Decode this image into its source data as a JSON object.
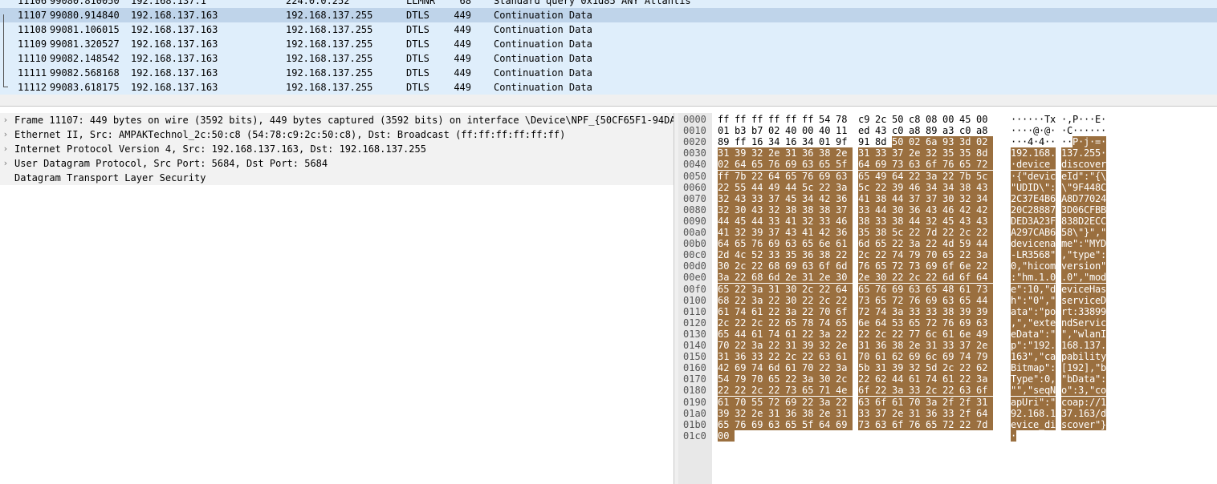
{
  "packet_list": {
    "rows": [
      {
        "no": "11106",
        "time": "99080.810050",
        "src": "192.168.137.1",
        "dst": "224.0.0.252",
        "proto": "LLMNR",
        "len": "68",
        "info": "Standard query 0x1d85 ANY Atlantis",
        "selected": false
      },
      {
        "no": "11107",
        "time": "99080.914840",
        "src": "192.168.137.163",
        "dst": "192.168.137.255",
        "proto": "DTLS",
        "len": "449",
        "info": "Continuation Data",
        "selected": true
      },
      {
        "no": "11108",
        "time": "99081.106015",
        "src": "192.168.137.163",
        "dst": "192.168.137.255",
        "proto": "DTLS",
        "len": "449",
        "info": "Continuation Data",
        "selected": false
      },
      {
        "no": "11109",
        "time": "99081.320527",
        "src": "192.168.137.163",
        "dst": "192.168.137.255",
        "proto": "DTLS",
        "len": "449",
        "info": "Continuation Data",
        "selected": false
      },
      {
        "no": "11110",
        "time": "99082.148542",
        "src": "192.168.137.163",
        "dst": "192.168.137.255",
        "proto": "DTLS",
        "len": "449",
        "info": "Continuation Data",
        "selected": false
      },
      {
        "no": "11111",
        "time": "99082.568168",
        "src": "192.168.137.163",
        "dst": "192.168.137.255",
        "proto": "DTLS",
        "len": "449",
        "info": "Continuation Data",
        "selected": false
      },
      {
        "no": "11112",
        "time": "99083.618175",
        "src": "192.168.137.163",
        "dst": "192.168.137.255",
        "proto": "DTLS",
        "len": "449",
        "info": "Continuation Data",
        "selected": false
      }
    ]
  },
  "details": {
    "rows": [
      {
        "text": "Frame 11107: 449 bytes on wire (3592 bits), 449 bytes captured (3592 bits) on interface \\Device\\NPF_{50CF65F1-94DA-",
        "expandable": true
      },
      {
        "text": "Ethernet II, Src: AMPAKTechnol_2c:50:c8 (54:78:c9:2c:50:c8), Dst: Broadcast (ff:ff:ff:ff:ff:ff)",
        "expandable": true
      },
      {
        "text": "Internet Protocol Version 4, Src: 192.168.137.163, Dst: 192.168.137.255",
        "expandable": true
      },
      {
        "text": "User Datagram Protocol, Src Port: 5684, Dst Port: 5684",
        "expandable": true
      },
      {
        "text": "Datagram Transport Layer Security",
        "expandable": false
      }
    ]
  },
  "bytes": {
    "highlight_start": 42,
    "rows": [
      {
        "offset": "0000",
        "hex": "ff ff ff ff ff ff 54 78 c9 2c 50 c8 08 00 45 00",
        "ascii": "······Tx ·,P···E·"
      },
      {
        "offset": "0010",
        "hex": "01 b3 b7 02 40 00 40 11 ed 43 c0 a8 89 a3 c0 a8",
        "ascii": "····@·@· ·C······"
      },
      {
        "offset": "0020",
        "hex": "89 ff 16 34 16 34 01 9f 91 8d 50 02 6a 93 3d 02",
        "ascii": "···4·4·· ··P·j·=·"
      },
      {
        "offset": "0030",
        "hex": "31 39 32 2e 31 36 38 2e 31 33 37 2e 32 35 35 8d",
        "ascii": "192.168. 137.255·"
      },
      {
        "offset": "0040",
        "hex": "02 64 65 76 69 63 65 5f 64 69 73 63 6f 76 65 72",
        "ascii": "·device_ discover"
      },
      {
        "offset": "0050",
        "hex": "ff 7b 22 64 65 76 69 63 65 49 64 22 3a 22 7b 5c",
        "ascii": "·{\"devic eId\":\"{\\"
      },
      {
        "offset": "0060",
        "hex": "22 55 44 49 44 5c 22 3a 5c 22 39 46 34 34 38 43",
        "ascii": "\"UDID\\\": \\\"9F448C"
      },
      {
        "offset": "0070",
        "hex": "32 43 33 37 45 34 42 36 41 38 44 37 37 30 32 34",
        "ascii": "2C37E4B6 A8D77024"
      },
      {
        "offset": "0080",
        "hex": "32 30 43 32 38 38 38 37 33 44 30 36 43 46 42 42",
        "ascii": "20C28887 3D06CFBB"
      },
      {
        "offset": "0090",
        "hex": "44 45 44 33 41 32 33 46 38 33 38 44 32 45 43 43",
        "ascii": "DED3A23F 838D2ECC"
      },
      {
        "offset": "00a0",
        "hex": "41 32 39 37 43 41 42 36 35 38 5c 22 7d 22 2c 22",
        "ascii": "A297CAB6 58\\\"}\",\""
      },
      {
        "offset": "00b0",
        "hex": "64 65 76 69 63 65 6e 61 6d 65 22 3a 22 4d 59 44",
        "ascii": "devicena me\":\"MYD"
      },
      {
        "offset": "00c0",
        "hex": "2d 4c 52 33 35 36 38 22 2c 22 74 79 70 65 22 3a",
        "ascii": "-LR3568\" ,\"type\":"
      },
      {
        "offset": "00d0",
        "hex": "30 2c 22 68 69 63 6f 6d 76 65 72 73 69 6f 6e 22",
        "ascii": "0,\"hicom version\""
      },
      {
        "offset": "00e0",
        "hex": "3a 22 68 6d 2e 31 2e 30 2e 30 22 2c 22 6d 6f 64",
        "ascii": ":\"hm.1.0 .0\",\"mod"
      },
      {
        "offset": "00f0",
        "hex": "65 22 3a 31 30 2c 22 64 65 76 69 63 65 48 61 73",
        "ascii": "e\":10,\"d eviceHas"
      },
      {
        "offset": "0100",
        "hex": "68 22 3a 22 30 22 2c 22 73 65 72 76 69 63 65 44",
        "ascii": "h\":\"0\",\" serviceD"
      },
      {
        "offset": "0110",
        "hex": "61 74 61 22 3a 22 70 6f 72 74 3a 33 33 38 39 39",
        "ascii": "ata\":\"po rt:33899"
      },
      {
        "offset": "0120",
        "hex": "2c 22 2c 22 65 78 74 65 6e 64 53 65 72 76 69 63",
        "ascii": ",\",\"exte ndServic"
      },
      {
        "offset": "0130",
        "hex": "65 44 61 74 61 22 3a 22 22 2c 22 77 6c 61 6e 49",
        "ascii": "eData\":\" \",\"wlanI"
      },
      {
        "offset": "0140",
        "hex": "70 22 3a 22 31 39 32 2e 31 36 38 2e 31 33 37 2e",
        "ascii": "p\":\"192. 168.137."
      },
      {
        "offset": "0150",
        "hex": "31 36 33 22 2c 22 63 61 70 61 62 69 6c 69 74 79",
        "ascii": "163\",\"ca pability"
      },
      {
        "offset": "0160",
        "hex": "42 69 74 6d 61 70 22 3a 5b 31 39 32 5d 2c 22 62",
        "ascii": "Bitmap\": [192],\"b"
      },
      {
        "offset": "0170",
        "hex": "54 79 70 65 22 3a 30 2c 22 62 44 61 74 61 22 3a",
        "ascii": "Type\":0, \"bData\":"
      },
      {
        "offset": "0180",
        "hex": "22 22 2c 22 73 65 71 4e 6f 22 3a 33 2c 22 63 6f",
        "ascii": "\"\",\"seqN o\":3,\"co"
      },
      {
        "offset": "0190",
        "hex": "61 70 55 72 69 22 3a 22 63 6f 61 70 3a 2f 2f 31",
        "ascii": "apUri\":\" coap://1"
      },
      {
        "offset": "01a0",
        "hex": "39 32 2e 31 36 38 2e 31 33 37 2e 31 36 33 2f 64",
        "ascii": "92.168.1 37.163/d"
      },
      {
        "offset": "01b0",
        "hex": "65 76 69 63 65 5f 64 69 73 63 6f 76 65 72 22 7d",
        "ascii": "evice_di scover\"}"
      },
      {
        "offset": "01c0",
        "hex": "00",
        "ascii": "·"
      }
    ]
  }
}
